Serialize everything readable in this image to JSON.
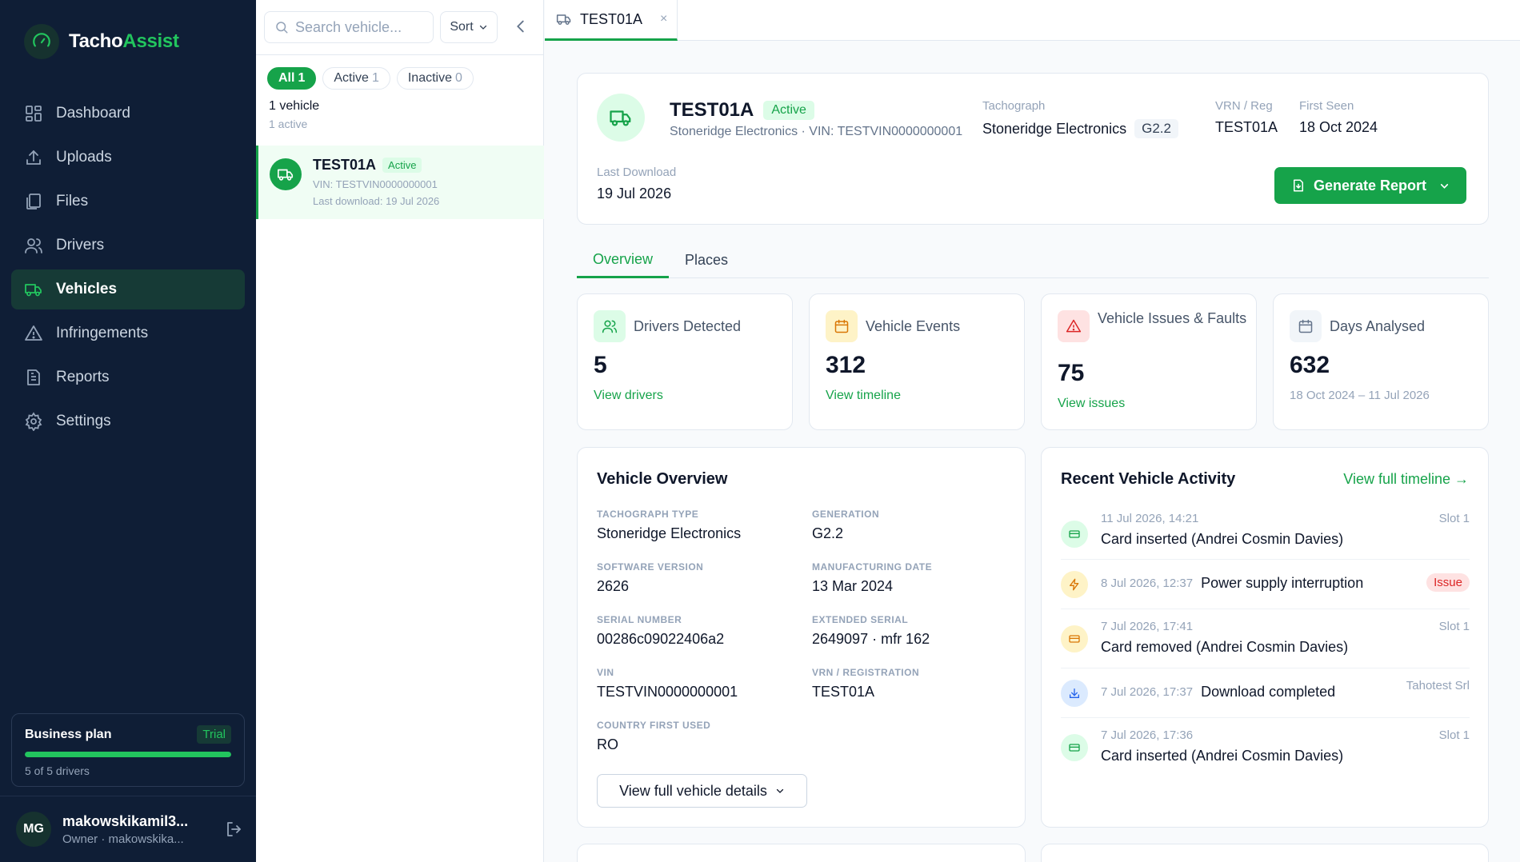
{
  "brand": {
    "name_main": "Tacho",
    "name_accent": "Assist"
  },
  "nav": {
    "items": [
      {
        "label": "Dashboard",
        "icon": "dashboard-icon"
      },
      {
        "label": "Uploads",
        "icon": "upload-icon"
      },
      {
        "label": "Files",
        "icon": "files-icon"
      },
      {
        "label": "Drivers",
        "icon": "drivers-icon"
      },
      {
        "label": "Vehicles",
        "icon": "truck-icon",
        "active": true
      },
      {
        "label": "Infringements",
        "icon": "warning-icon"
      },
      {
        "label": "Reports",
        "icon": "report-icon"
      },
      {
        "label": "Settings",
        "icon": "gear-icon"
      }
    ]
  },
  "plan": {
    "name": "Business plan",
    "badge": "Trial",
    "usage": "5 of 5 drivers",
    "used": 5,
    "limit": 5
  },
  "user": {
    "initials": "MG",
    "name": "makowskikamil3...",
    "role": "Owner · makowskika..."
  },
  "list": {
    "search_placeholder": "Search vehicle...",
    "sort_label": "Sort",
    "filters": [
      {
        "label": "All",
        "count": "1",
        "active": true
      },
      {
        "label": "Active",
        "count": "1"
      },
      {
        "label": "Inactive",
        "count": "0"
      }
    ],
    "count_line": "1 vehicle",
    "count_sub": "1 active",
    "items": [
      {
        "name": "TEST01A",
        "status": "Active",
        "vin": "VIN: TESTVIN0000000001",
        "last_download": "Last download: 19 Jul 2026"
      }
    ]
  },
  "tab": {
    "label": "TEST01A",
    "close": "×"
  },
  "header": {
    "name": "TEST01A",
    "status": "Active",
    "subtitle": "Stoneridge Electronics · VIN: TESTVIN0000000001",
    "tachograph_label": "Tachograph",
    "tachograph_value": "Stoneridge Electronics",
    "generation": "G2.2",
    "vrn_label": "VRN / Reg",
    "vrn_value": "TEST01A",
    "first_seen_label": "First Seen",
    "first_seen_value": "18 Oct 2024",
    "last_download_label": "Last Download",
    "last_download_value": "19 Jul 2026",
    "generate_label": "Generate Report"
  },
  "content_tabs": [
    {
      "label": "Overview",
      "active": true
    },
    {
      "label": "Places"
    }
  ],
  "stats": [
    {
      "label": "Drivers Detected",
      "value": "5",
      "link": "View drivers",
      "icon": "drivers-icon"
    },
    {
      "label": "Vehicle Events",
      "value": "312",
      "link": "View timeline",
      "icon": "calendar-icon"
    },
    {
      "label": "Vehicle Issues & Faults",
      "value": "75",
      "link": "View issues",
      "icon": "warning-icon"
    },
    {
      "label": "Days Analysed",
      "value": "632",
      "note": "18 Oct 2024 – 11 Jul 2026",
      "icon": "calendar-icon"
    }
  ],
  "overview": {
    "title": "Vehicle Overview",
    "fields": [
      {
        "label": "Tachograph Type",
        "value": "Stoneridge Electronics"
      },
      {
        "label": "Generation",
        "value": "G2.2"
      },
      {
        "label": "Software Version",
        "value": "2626"
      },
      {
        "label": "Manufacturing Date",
        "value": "13 Mar 2024"
      },
      {
        "label": "Serial Number",
        "value": "00286c09022406a2"
      },
      {
        "label": "Extended Serial",
        "value": "2649097 · mfr 162"
      },
      {
        "label": "VIN",
        "value": "TESTVIN0000000001"
      },
      {
        "label": "VRN / Registration",
        "value": "TEST01A"
      },
      {
        "label": "Country First Used",
        "value": "RO"
      }
    ],
    "details_button": "View full vehicle details"
  },
  "activity": {
    "title": "Recent Vehicle Activity",
    "link": "View full timeline →",
    "items": [
      {
        "time": "11 Jul 2026, 14:21",
        "text": "Card inserted (Andrei Cosmin Davies)",
        "tag": "Slot 1",
        "icon": "card-icon",
        "color": "#16a34a"
      },
      {
        "time": "8 Jul 2026, 12:37",
        "text": "Power supply interruption",
        "issue": "Issue",
        "icon": "lightning-icon",
        "color": "#d97706"
      },
      {
        "time": "7 Jul 2026, 17:41",
        "text": "Card removed (Andrei Cosmin Davies)",
        "tag": "Slot 1",
        "icon": "card-icon",
        "color": "#d97706"
      },
      {
        "time": "7 Jul 2026, 17:37",
        "text": "Download completed",
        "tag": "Tahotest Srl",
        "icon": "download-icon",
        "color": "#2563eb"
      },
      {
        "time": "7 Jul 2026, 17:36",
        "text": "Card inserted (Andrei Cosmin Davies)",
        "tag": "Slot 1",
        "icon": "card-icon",
        "color": "#16a34a"
      }
    ]
  }
}
